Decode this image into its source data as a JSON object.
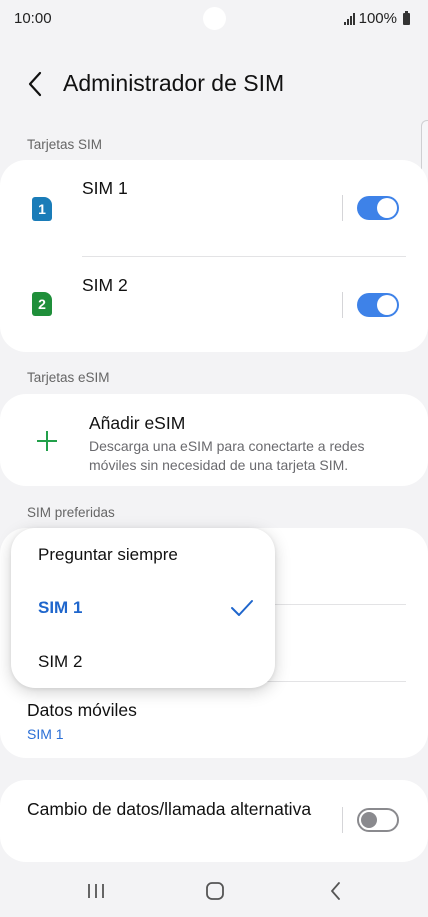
{
  "status_bar": {
    "time": "10:00",
    "battery": "100%"
  },
  "header": {
    "title": "Administrador de SIM"
  },
  "sim_cards": {
    "label": "Tarjetas SIM",
    "items": [
      {
        "badge": "1",
        "name": "SIM 1",
        "badge_color": "#1a7cb8",
        "enabled": true
      },
      {
        "badge": "2",
        "name": "SIM 2",
        "badge_color": "#1f8f3a",
        "enabled": true
      }
    ]
  },
  "esim": {
    "label": "Tarjetas eSIM",
    "add_title": "Añadir eSIM",
    "add_description": "Descarga una eSIM para conectarte a redes móviles sin necesidad de una tarjeta SIM."
  },
  "preferred": {
    "label": "SIM preferidas",
    "mobile_data_title": "Datos móviles",
    "mobile_data_value": "SIM 1"
  },
  "popup": {
    "options": [
      "Preguntar siempre",
      "SIM 1",
      "SIM 2"
    ],
    "selected": "SIM 1"
  },
  "data_switch": {
    "title": "Cambio de datos/llamada alternativa",
    "enabled": false
  },
  "colors": {
    "accent": "#3e82e8",
    "selected_text": "#1f66cc",
    "plus": "#22a04a"
  }
}
